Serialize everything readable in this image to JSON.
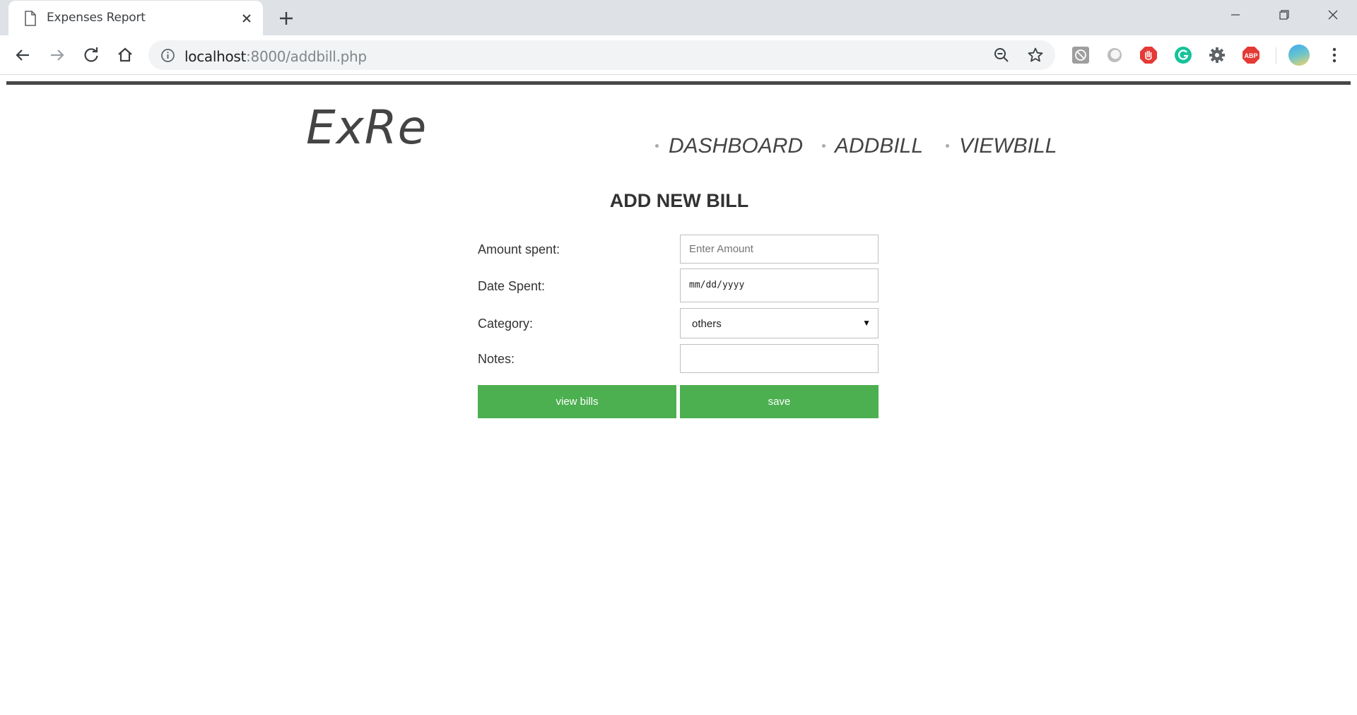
{
  "browser": {
    "tab_title": "Expenses Report",
    "url_host": "localhost",
    "url_path": ":8000/addbill.php"
  },
  "page": {
    "logo": "ExRe",
    "nav": [
      {
        "label": "DASHBOARD"
      },
      {
        "label": "ADDBILL"
      },
      {
        "label": "VIEWBILL"
      }
    ],
    "title": "ADD NEW BILL",
    "form": {
      "amount_label": "Amount spent:",
      "amount_placeholder": "Enter Amount",
      "date_label": "Date Spent:",
      "date_value": "mm/dd/yyyy",
      "category_label": "Category:",
      "category_value": "others",
      "notes_label": "Notes:",
      "notes_value": ""
    },
    "buttons": {
      "view_bills": "view bills",
      "save": "save"
    }
  },
  "colors": {
    "button_green": "#4caf50",
    "text_dark": "#333333",
    "rule": "#474747"
  }
}
